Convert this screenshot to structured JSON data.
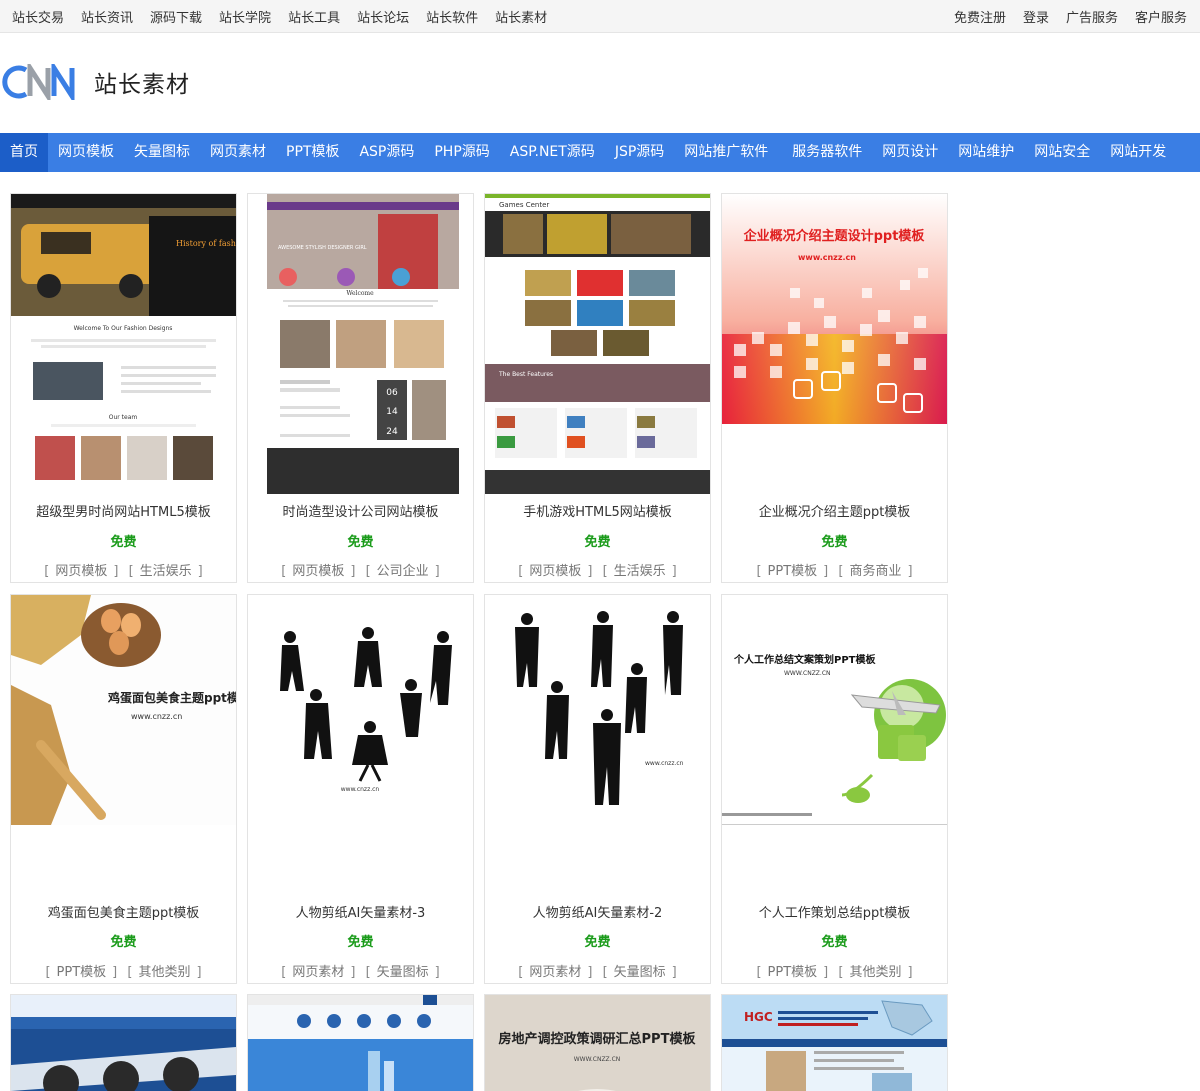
{
  "topbar": {
    "left_links": [
      "站长交易",
      "站长资讯",
      "源码下载",
      "站长学院",
      "站长工具",
      "站长论坛",
      "站长软件",
      "站长素材"
    ],
    "right_links": [
      "免费注册",
      "登录",
      "广告服务",
      "客户服务"
    ]
  },
  "logo": {
    "text": "站长素材",
    "mark": "CNN"
  },
  "nav": [
    "首页",
    "网页模板",
    "矢量图标",
    "网页素材",
    "PPT模板",
    "ASP源码",
    "PHP源码",
    "ASP.NET源码",
    "JSP源码",
    "网站推广软件",
    "服务器软件",
    "网页设计",
    "网站维护",
    "网站安全",
    "网站开发"
  ],
  "cards": [
    {
      "title": "超级型男时尚网站HTML5模板",
      "price": "免费",
      "tags": [
        "网页模板",
        "生活娱乐"
      ],
      "thumb": "fashion-site"
    },
    {
      "title": "时尚造型设计公司网站模板",
      "price": "免费",
      "tags": [
        "网页模板",
        "公司企业"
      ],
      "thumb": "styling-site"
    },
    {
      "title": "手机游戏HTML5网站模板",
      "price": "免费",
      "tags": [
        "网页模板",
        "生活娱乐"
      ],
      "thumb": "game-site"
    },
    {
      "title": "企业概况介绍主题ppt模板",
      "price": "免费",
      "tags": [
        "PPT模板",
        "商务商业"
      ],
      "thumb": "ppt-squares"
    },
    {
      "title": "鸡蛋面包美食主题ppt模板",
      "price": "免费",
      "tags": [
        "PPT模板",
        "其他类别"
      ],
      "thumb": "ppt-bread"
    },
    {
      "title": "人物剪纸AI矢量素材-3",
      "price": "免费",
      "tags": [
        "网页素材",
        "矢量图标"
      ],
      "thumb": "silhouettes-1"
    },
    {
      "title": "人物剪纸AI矢量素材-2",
      "price": "免费",
      "tags": [
        "网页素材",
        "矢量图标"
      ],
      "thumb": "silhouettes-2"
    },
    {
      "title": "个人工作策划总结ppt模板",
      "price": "免费",
      "tags": [
        "PPT模板",
        "其他类别"
      ],
      "thumb": "ppt-plane"
    },
    {
      "title": "",
      "price": "",
      "tags": [],
      "thumb": "airport-site"
    },
    {
      "title": "",
      "price": "",
      "tags": [],
      "thumb": "blue-site"
    },
    {
      "title": "",
      "price": "",
      "tags": [],
      "thumb": "ppt-realestate"
    },
    {
      "title": "",
      "price": "",
      "tags": [],
      "thumb": "map-site"
    }
  ],
  "thumb_text": {
    "fashion_heading": "History of fashion",
    "fashion_welcome": "Welcome To Our Fashion Designs",
    "fashion_team": "Our team",
    "styling_tagline": "AWESOME STYLISH DESIGNER GIRL",
    "styling_welcome": "Welcome",
    "styling_dates": [
      "06",
      "14",
      "24"
    ],
    "game_header": "Games Center",
    "game_features": "The Best Features",
    "ppt_title": "企业概况介绍主题设计ppt模板",
    "ppt_url": "www.cnzz.cn",
    "bread_title": "鸡蛋面包美食主题ppt模板",
    "bread_url": "www.cnzz.cn",
    "sil_url": "www.cnzz.cn",
    "plane_title": "个人工作总结文案策划PPT模板",
    "plane_url": "WWW.CNZZ.CN",
    "realestate_title": "房地产调控政策调研汇总PPT模板",
    "realestate_url": "WWW.CNZZ.CN",
    "map_logo": "HGC"
  }
}
